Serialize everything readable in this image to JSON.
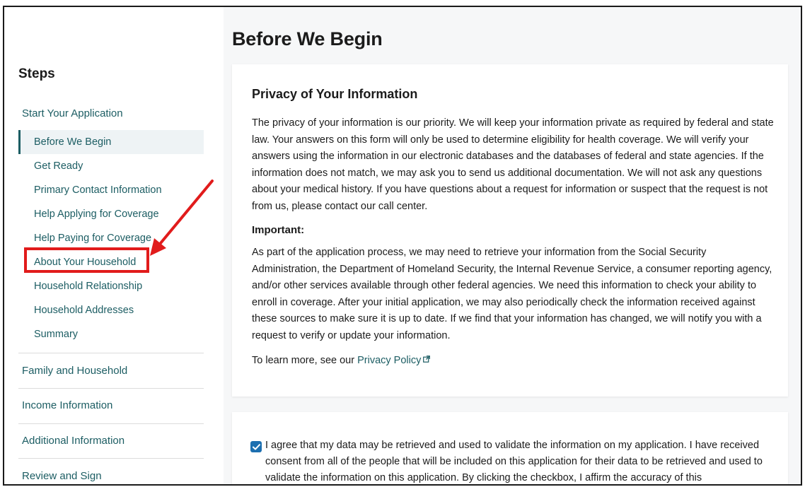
{
  "sidebar": {
    "title": "Steps",
    "current_section": "Start Your Application",
    "sub_items": [
      {
        "label": "Before We Begin",
        "active": true
      },
      {
        "label": "Get Ready"
      },
      {
        "label": "Primary Contact Information"
      },
      {
        "label": "Help Applying for Coverage"
      },
      {
        "label": "Help Paying for Coverage"
      },
      {
        "label": "About Your Household",
        "highlighted": true
      },
      {
        "label": "Household Relationship"
      },
      {
        "label": "Household Addresses"
      },
      {
        "label": "Summary"
      }
    ],
    "sections": [
      {
        "label": "Family and Household"
      },
      {
        "label": "Income Information"
      },
      {
        "label": "Additional Information"
      },
      {
        "label": "Review and Sign"
      }
    ]
  },
  "main": {
    "page_title": "Before We Begin",
    "privacy_card": {
      "title": "Privacy of Your Information",
      "paragraph1": "The privacy of your information is our priority. We will keep your information private as required by federal and state law. Your answers on this form will only be used to determine eligibility for health coverage. We will verify your answers using the information in our electronic databases and the databases of federal and state agencies. If the information does not match, we may ask you to send us additional documentation. We will not ask any questions about your medical history. If you have questions about a request for information or suspect that the request is not from us, please contact our call center.",
      "important_label": "Important:",
      "paragraph2": "As part of the application process, we may need to retrieve your information from the Social Security Administration, the Department of Homeland Security, the Internal Revenue Service, a consumer reporting agency, and/or other services available through other federal agencies. We need this information to check your ability to enroll in coverage. After your initial application, we may also periodically check the information received against these sources to make sure it is up to date. If we find that your information has changed, we will notify you with a request to verify or update your information.",
      "learn_more_prefix": "To learn more, see our ",
      "privacy_link": "Privacy Policy"
    },
    "consent_card": {
      "checked": true,
      "text": "I agree that my data may be retrieved and used to validate the information on my application. I have received consent from all of the people that will be included on this application for their data to be retrieved and used to validate the information on this application. By clicking the checkbox, I affirm the accuracy of this"
    }
  },
  "colors": {
    "accent_teal": "#1c5d63",
    "annotation_red": "#e11b1b",
    "checkbox_blue": "#1c6fb0",
    "main_background": "#f6f7f8"
  }
}
